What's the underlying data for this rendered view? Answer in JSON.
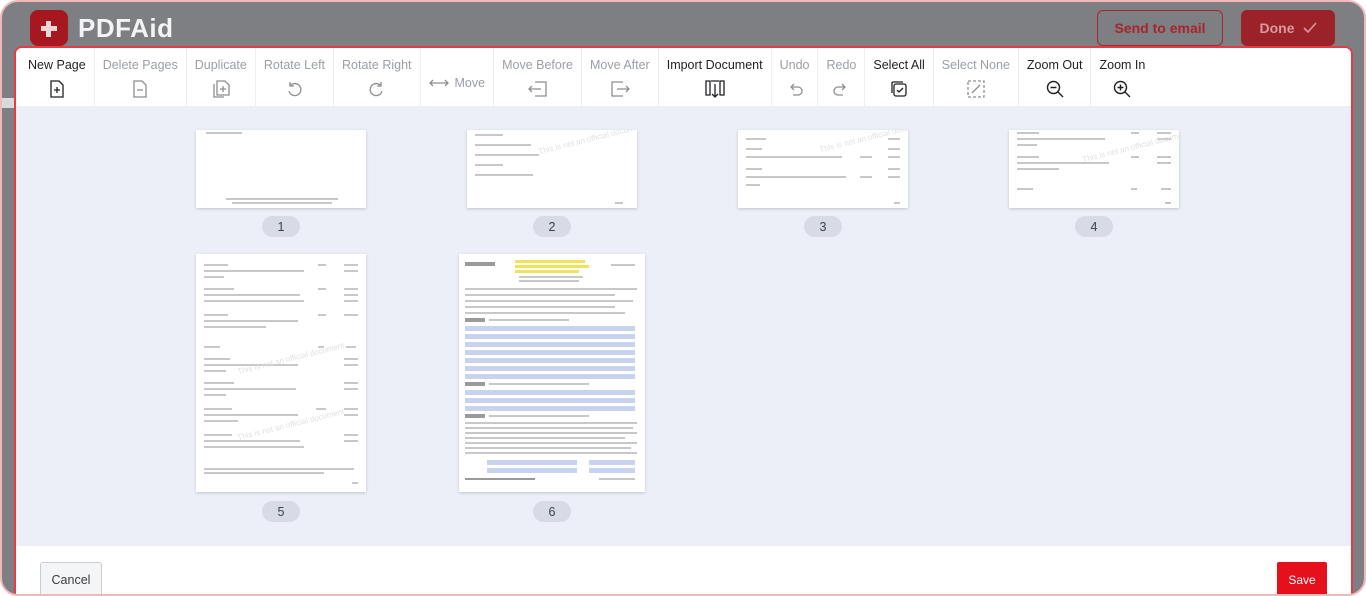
{
  "app": {
    "logo_text": "PDFAid",
    "send_to_email_label": "Send to email",
    "done_label": "Done",
    "brand_color": "#e5101c"
  },
  "toolbar": {
    "items": [
      {
        "label": "New Page",
        "icon": "new-page-icon",
        "enabled": true
      },
      {
        "label": "Delete Pages",
        "icon": "delete-pages-icon",
        "enabled": false
      },
      {
        "label": "Duplicate",
        "icon": "duplicate-icon",
        "enabled": false
      },
      {
        "label": "Rotate Left",
        "icon": "rotate-left-icon",
        "enabled": false
      },
      {
        "label": "Rotate Right",
        "icon": "rotate-right-icon",
        "enabled": false
      },
      {
        "label": "Move",
        "icon": "move-icon",
        "enabled": false
      },
      {
        "label": "Move Before",
        "icon": "move-before-icon",
        "enabled": false
      },
      {
        "label": "Move After",
        "icon": "move-after-icon",
        "enabled": false
      },
      {
        "label": "Import Document",
        "icon": "import-document-icon",
        "enabled": true
      },
      {
        "label": "Undo",
        "icon": "undo-icon",
        "enabled": false
      },
      {
        "label": "Redo",
        "icon": "redo-icon",
        "enabled": false
      },
      {
        "label": "Select All",
        "icon": "select-all-icon",
        "enabled": true
      },
      {
        "label": "Select None",
        "icon": "select-none-icon",
        "enabled": false
      },
      {
        "label": "Zoom Out",
        "icon": "zoom-out-icon",
        "enabled": true
      },
      {
        "label": "Zoom In",
        "icon": "zoom-in-icon",
        "enabled": true
      }
    ]
  },
  "pages": [
    {
      "number": "1"
    },
    {
      "number": "2"
    },
    {
      "number": "3"
    },
    {
      "number": "4"
    },
    {
      "number": "5"
    },
    {
      "number": "6"
    }
  ],
  "footer": {
    "cancel_label": "Cancel",
    "save_label": "Save"
  }
}
